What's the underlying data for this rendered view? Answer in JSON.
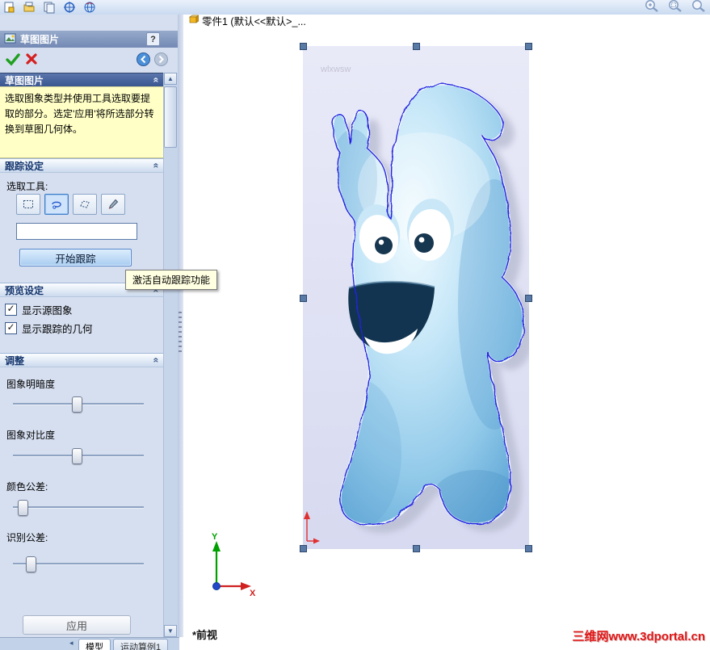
{
  "window": {
    "document_tab": "零件1 (默认<<默认>_..."
  },
  "toolbar": {
    "icons": [
      "new-part-icon",
      "open-icon",
      "copy-icon",
      "target-icon",
      "web-icon"
    ],
    "zoom_icons": [
      "zoom-in-icon",
      "zoom-window-icon",
      "zoom-fit-icon"
    ]
  },
  "panel": {
    "title": "草图图片",
    "help_label": "?",
    "section_header": "草图图片",
    "info_text": "选取图象类型并使用工具选取要提取的部分。选定'应用'将所选部分转换到草图几何体。",
    "trace": {
      "header": "跟踪设定",
      "tools_label": "选取工具:",
      "tools": [
        "rect-select",
        "lasso-select",
        "polygon-select",
        "color-picker"
      ],
      "input_value": "",
      "start_button": "开始跟踪"
    },
    "tooltip": "激活自动跟踪功能",
    "preview": {
      "header": "预览设定",
      "options": [
        {
          "label": "显示源图象",
          "checked": true
        },
        {
          "label": "显示跟踪的几何",
          "checked": true
        }
      ]
    },
    "adjust": {
      "header": "调整",
      "sliders": [
        {
          "label": "图象明暗度",
          "value": 48
        },
        {
          "label": "图象对比度",
          "value": 48
        },
        {
          "label": "颜色公差:",
          "value": 7
        },
        {
          "label": "识别公差:",
          "value": 13
        }
      ]
    },
    "apply_button": "应用"
  },
  "statusbar": {
    "tabs": [
      "模型",
      "运动算例1"
    ]
  },
  "viewport": {
    "view_name": "*前视",
    "axis_x": "X",
    "axis_y": "Y",
    "watermark": "三维网www.3dportal.cn",
    "image_watermark": "wlxwsw"
  },
  "icons": {
    "collapse_glyph": "«",
    "check_glyph": "✓",
    "tab_scroll_glyph": "◂",
    "scroll_up_glyph": "▲",
    "scroll_down_glyph": "▼"
  },
  "colors": {
    "trace_outline": "#2424e0",
    "watermark_red": "#e01818",
    "panel_bg": "#d6dff0",
    "info_bg": "#ffffc6"
  }
}
